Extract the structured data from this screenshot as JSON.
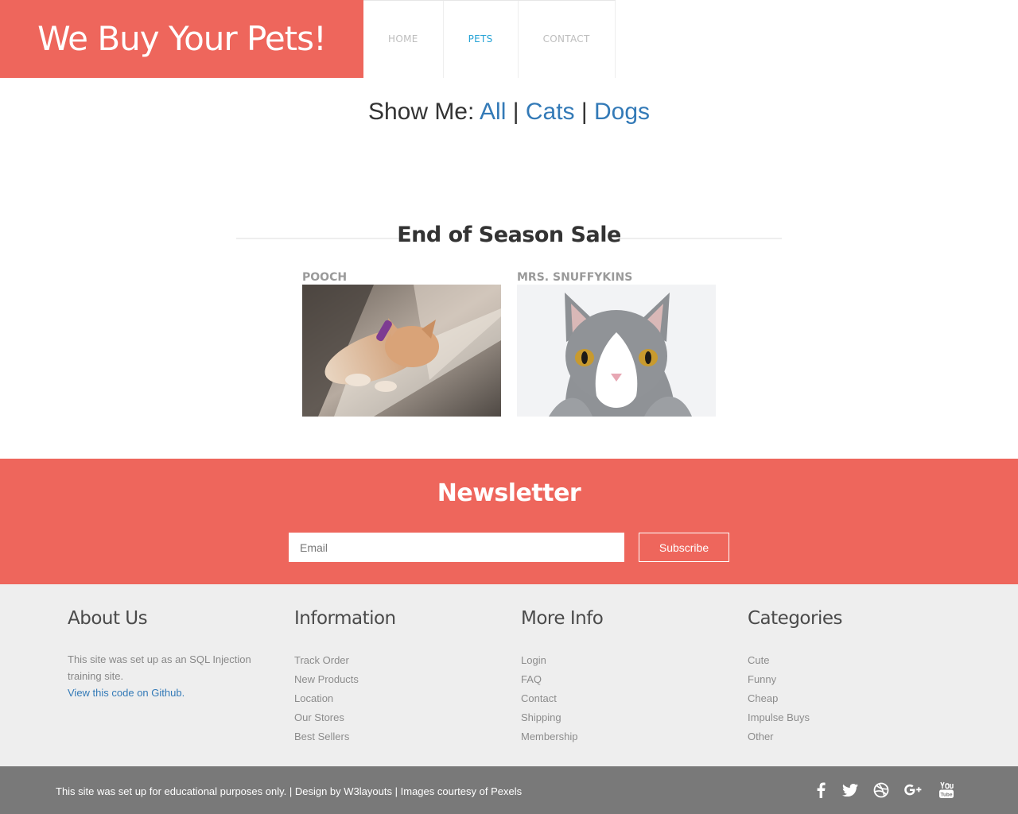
{
  "header": {
    "logo": "We Buy Your Pets!",
    "nav": [
      {
        "label": "HOME"
      },
      {
        "label": "PETS"
      },
      {
        "label": "CONTACT"
      }
    ]
  },
  "filter": {
    "prefix": "Show Me:",
    "links": [
      "All",
      "Cats",
      "Dogs"
    ],
    "separator": "|"
  },
  "sale": {
    "title": "End of Season Sale",
    "pets": [
      {
        "name": "POOCH"
      },
      {
        "name": "MRS. SNUFFYKINS"
      }
    ]
  },
  "newsletter": {
    "title": "Newsletter",
    "email_placeholder": "Email",
    "subscribe_label": "Subscribe"
  },
  "footer": {
    "about": {
      "title": "About Us",
      "text": "This site was set up as an SQL Injection training site.",
      "link": "View this code on Github."
    },
    "information": {
      "title": "Information",
      "items": [
        "Track Order",
        "New Products",
        "Location",
        "Our Stores",
        "Best Sellers"
      ]
    },
    "more_info": {
      "title": "More Info",
      "items": [
        "Login",
        "FAQ",
        "Contact",
        "Shipping",
        "Membership"
      ]
    },
    "categories": {
      "title": "Categories",
      "items": [
        "Cute",
        "Funny",
        "Cheap",
        "Impulse Buys",
        "Other"
      ]
    }
  },
  "bottom": {
    "copyright_text": "This site was set up for educational purposes only. | Design by",
    "design_link": "W3layouts",
    "middle_sep": "|",
    "images_link": "Images courtesy of Pexels",
    "social": [
      "facebook-icon",
      "twitter-icon",
      "dribbble-icon",
      "google-plus-icon",
      "youtube-icon"
    ]
  },
  "colors": {
    "accent": "#ee665c",
    "nav_active": "#26a3d6",
    "link": "#337ab7",
    "footer_bg": "#eeeeee",
    "bottom_bg": "#797979"
  }
}
